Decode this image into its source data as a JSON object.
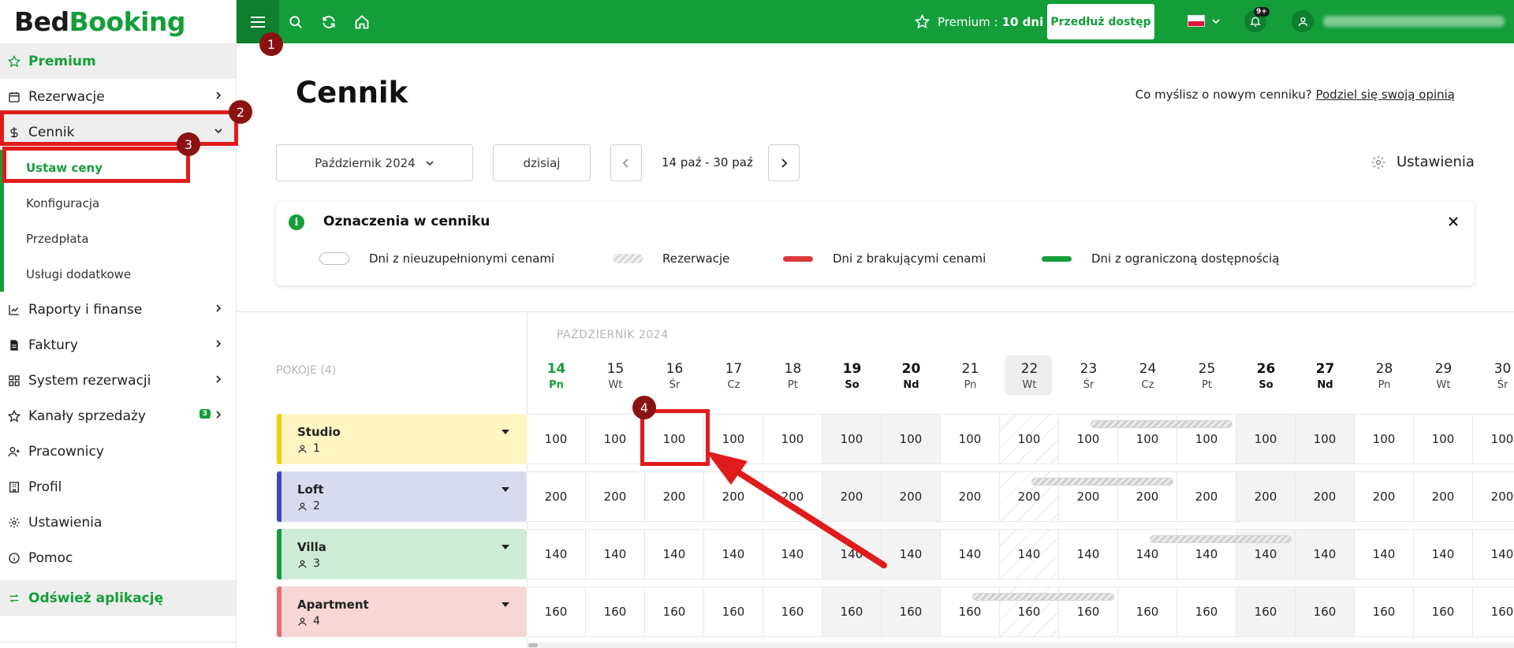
{
  "logo": {
    "part1": "Bed",
    "part2": "Booking"
  },
  "sidebar": {
    "premium": "Premium",
    "items": [
      {
        "label": "Rezerwacje",
        "icon": "calendar-icon"
      },
      {
        "label": "Cennik",
        "icon": "dollar-icon"
      }
    ],
    "cennik_sub": [
      "Ustaw ceny",
      "Konfiguracja",
      "Przedpłata",
      "Usługi dodatkowe"
    ],
    "items2": [
      {
        "label": "Raporty i finanse",
        "icon": "chart-icon"
      },
      {
        "label": "Faktury",
        "icon": "invoice-icon"
      },
      {
        "label": "System rezerwacji",
        "icon": "grid-icon"
      },
      {
        "label": "Kanały sprzedaży",
        "icon": "star-icon",
        "badge": "3"
      },
      {
        "label": "Pracownicy",
        "icon": "user-plus-icon"
      },
      {
        "label": "Profil",
        "icon": "building-icon"
      },
      {
        "label": "Ustawienia",
        "icon": "gear-icon"
      },
      {
        "label": "Pomoc",
        "icon": "info-icon"
      }
    ],
    "refresh": "Odśwież aplikację"
  },
  "topbar": {
    "premium_label": "Premium :",
    "premium_days": "10 dni",
    "extend": "Przedłuż dostęp",
    "notifications": "9+"
  },
  "page": {
    "title": "Cennik",
    "feedback_q": "Co myślisz o nowym cenniku?",
    "feedback_link": "Podziel się swoją opinią"
  },
  "controls": {
    "month": "Październik 2024",
    "today": "dzisiaj",
    "range": "14 paź - 30 paź",
    "settings": "Ustawienia"
  },
  "legend": {
    "title": "Oznaczenia w cenniku",
    "items": [
      "Dni z nieuzupełnionymi cenami",
      "Rezerwacje",
      "Dni z brakującymi cenami",
      "Dni z ograniczoną dostępnością"
    ]
  },
  "calendar": {
    "month_label": "PAŹDZIERNIK 2024",
    "rooms_label": "POKOJE (4)",
    "days": [
      {
        "d": "14",
        "w": "Pn",
        "type": "today"
      },
      {
        "d": "15",
        "w": "Wt",
        "type": ""
      },
      {
        "d": "16",
        "w": "Śr",
        "type": ""
      },
      {
        "d": "17",
        "w": "Cz",
        "type": ""
      },
      {
        "d": "18",
        "w": "Pt",
        "type": ""
      },
      {
        "d": "19",
        "w": "So",
        "type": "weekend"
      },
      {
        "d": "20",
        "w": "Nd",
        "type": "weekend"
      },
      {
        "d": "21",
        "w": "Pn",
        "type": ""
      },
      {
        "d": "22",
        "w": "Wt",
        "type": "selected"
      },
      {
        "d": "23",
        "w": "Śr",
        "type": ""
      },
      {
        "d": "24",
        "w": "Cz",
        "type": ""
      },
      {
        "d": "25",
        "w": "Pt",
        "type": ""
      },
      {
        "d": "26",
        "w": "So",
        "type": "weekend"
      },
      {
        "d": "27",
        "w": "Nd",
        "type": "weekend"
      },
      {
        "d": "28",
        "w": "Pn",
        "type": ""
      },
      {
        "d": "29",
        "w": "Wt",
        "type": ""
      },
      {
        "d": "30",
        "w": "Śr",
        "type": ""
      }
    ],
    "rooms": [
      {
        "name": "Studio",
        "guests": "1",
        "color": "#fff6c4",
        "accent": "#f2d000",
        "price": "100",
        "booking_days": [
          "23",
          "25"
        ]
      },
      {
        "name": "Loft",
        "guests": "2",
        "color": "#d8dbf0",
        "accent": "#3b4bb5",
        "price": "200",
        "booking_days": [
          "22",
          "24"
        ]
      },
      {
        "name": "Villa",
        "guests": "3",
        "color": "#cdebd7",
        "accent": "#149e3a",
        "price": "140",
        "booking_days": [
          "24",
          "26"
        ]
      },
      {
        "name": "Apartment",
        "guests": "4",
        "color": "#f7d6d6",
        "accent": "#e07070",
        "price": "160",
        "booking_days": [
          "21",
          "23"
        ]
      }
    ]
  },
  "annotations": [
    "1",
    "2",
    "3",
    "4"
  ],
  "colors": {
    "brand": "#149e3a",
    "annotation": "#e01b1b"
  }
}
